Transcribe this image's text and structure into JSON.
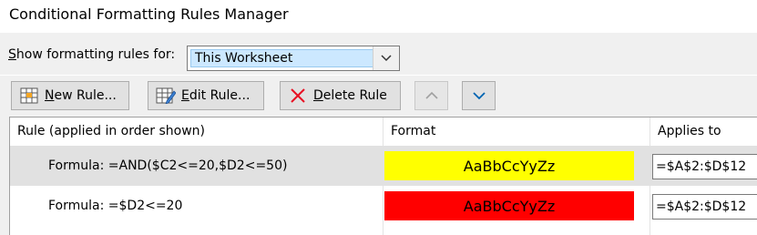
{
  "window": {
    "title": "Conditional Formatting Rules Manager"
  },
  "filter": {
    "label_prefix": "",
    "label_accel": "S",
    "label_rest": "how formatting rules for:",
    "selected": "This Worksheet"
  },
  "toolbar": {
    "new_rule_accel": "N",
    "new_rule_rest": "ew Rule...",
    "edit_rule_accel": "E",
    "edit_rule_rest": "dit Rule...",
    "delete_rule_accel": "D",
    "delete_rule_rest": "elete Rule"
  },
  "grid": {
    "headers": {
      "rule": "Rule (applied in order shown)",
      "format": "Format",
      "applies_to": "Applies to"
    },
    "rows": [
      {
        "rule": "Formula: =AND($C2<=20,$D2<=50)",
        "preview": "AaBbCcYyZz",
        "fill": "#ffff00",
        "applies_to": "=$A$2:$D$12",
        "selected": true
      },
      {
        "rule": "Formula: =$D2<=20",
        "preview": "AaBbCcYyZz",
        "fill": "#ff0000",
        "applies_to": "=$A$2:$D$12",
        "selected": false
      }
    ]
  },
  "icons": {
    "new_rule": "table-new-icon",
    "edit_rule": "table-edit-icon",
    "delete_rule": "red-x-icon",
    "move_up": "chevron-up-icon",
    "move_down": "chevron-down-icon"
  },
  "colors": {
    "selected_value_bg": "#cce8ff",
    "row_selected_bg": "#e1e1e1",
    "accent_blue": "#0063b1"
  }
}
